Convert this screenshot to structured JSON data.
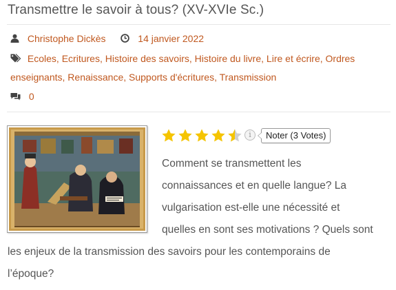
{
  "post": {
    "title": "Transmettre le savoir à tous? (XV-XVIe Sc.)",
    "author": "Christophe Dickès",
    "date": "14 janvier 2022",
    "comments_count": "0",
    "tags": [
      "Ecoles",
      "Ecritures",
      "Histoire des savoirs",
      "Histoire du livre",
      "Lire et écrire",
      "Ordres enseignants",
      "Renaissance",
      "Supports d'écritures",
      "Transmission"
    ]
  },
  "rating": {
    "value": 4.5,
    "max": 5,
    "button_label": "Noter (3 Votes)",
    "info_icon": "i"
  },
  "excerpt": {
    "lines": [
      "Comment se transmettent les",
      "connaissances et en quelle langue? La",
      "vulgarisation est-elle une nécessité et",
      "quelles en sont ses motivations ? Quels sont",
      "les enjeux de la transmission des savoirs pour les contemporains de",
      "l’époque?"
    ]
  },
  "icons": {
    "author": "user-icon",
    "date": "clock-icon",
    "tags": "tags-icon",
    "comments": "comments-icon",
    "info": "info-icon",
    "star": "star-icon"
  },
  "colors": {
    "link": "#c0581f",
    "star": "#f5c400",
    "star_empty": "#cfcfcf",
    "text": "#555555"
  }
}
